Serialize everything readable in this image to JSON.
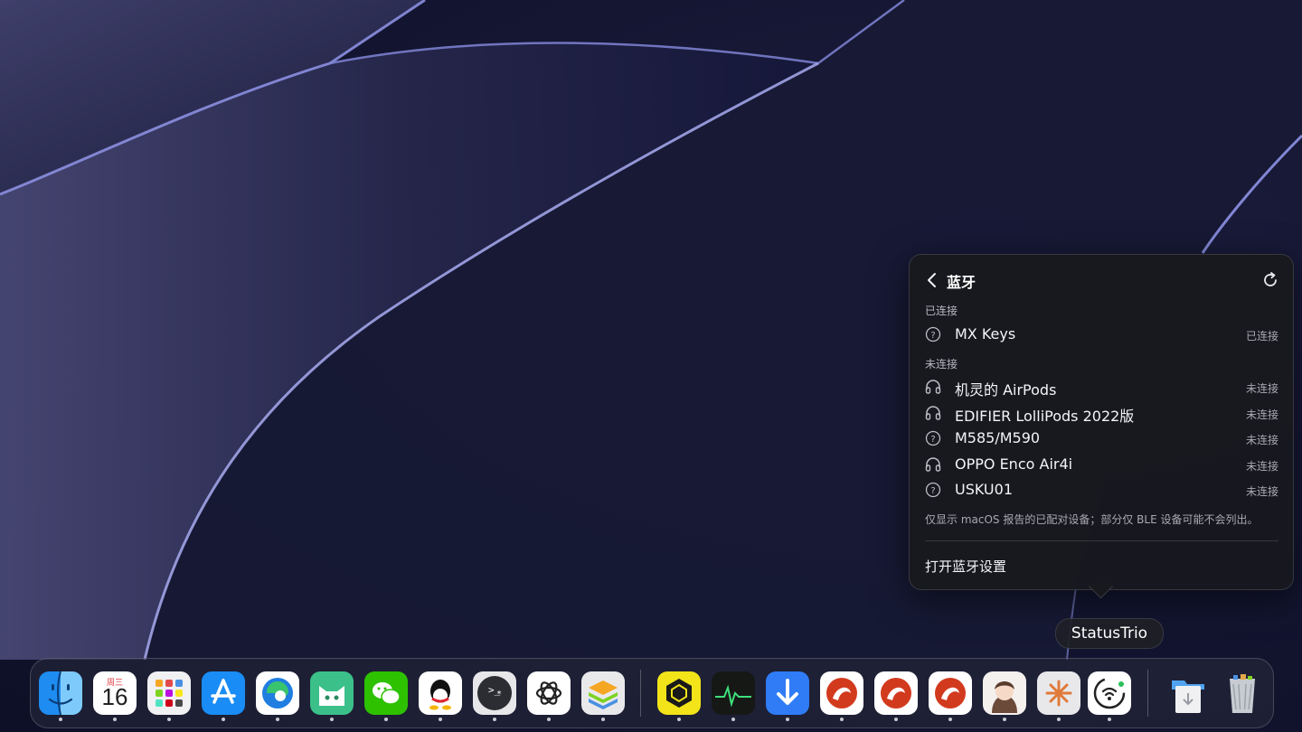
{
  "popover": {
    "title": "蓝牙",
    "connected_label": "已连接",
    "disconnected_label": "未连接",
    "devices": [
      {
        "name": "MX Keys",
        "status": "已连接",
        "icon": "question-icon"
      },
      {
        "name": "机灵的 AirPods",
        "status": "未连接",
        "icon": "headphones-icon"
      },
      {
        "name": "EDIFIER LolliPods 2022版",
        "status": "未连接",
        "icon": "headphones-icon"
      },
      {
        "name": "M585/M590",
        "status": "未连接",
        "icon": "question-icon"
      },
      {
        "name": "OPPO Enco Air4i",
        "status": "未连接",
        "icon": "headphones-icon"
      },
      {
        "name": "USKU01",
        "status": "未连接",
        "icon": "question-icon"
      }
    ],
    "note": "仅显示 macOS 报告的已配对设备；部分仅 BLE 设备可能不会列出。",
    "open_settings": "打开蓝牙设置"
  },
  "tooltip": "StatusTrio",
  "dock": {
    "calendar_weekday": "周三",
    "calendar_date": "16",
    "apps": [
      "finder-icon",
      "calendar-icon",
      "launchpad-icon",
      "app-store-icon",
      "edge-icon",
      "cat-app-icon",
      "wechat-icon",
      "qq-icon",
      "terminal-icon",
      "chatgpt-icon",
      "stack-app-icon",
      "hexagon-app-icon",
      "activity-monitor-icon",
      "downloader-icon",
      "red-app-1-icon",
      "red-app-2-icon",
      "red-app-3-icon",
      "avatar-app-icon",
      "claude-icon",
      "statustrio-icon",
      "downloads-folder-icon",
      "trash-icon"
    ]
  },
  "colors": {
    "accent": "#2f7cf6",
    "popover_bg": "#18191e",
    "wallpaper": "#141632"
  }
}
